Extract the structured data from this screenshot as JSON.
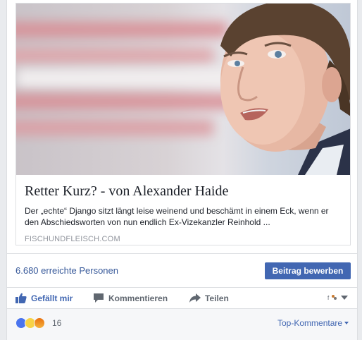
{
  "link_preview": {
    "title": "Retter Kurz? - von Alexander Haide",
    "description": "Der „echte“ Django sitzt längt leise weinend und beschämt in einem Eck, wenn er den Abschiedsworten von nun endlich Ex-Vizekanzler Reinhold ...",
    "domain": "FISCHUNDFLEISCH.COM"
  },
  "reach": {
    "text": "6.680 erreichte Personen",
    "boost_label": "Beitrag bewerben"
  },
  "actions": {
    "like_label": "Gefällt mir",
    "comment_label": "Kommentieren",
    "share_label": "Teilen"
  },
  "reactions": {
    "icons": [
      "like-icon",
      "haha-icon",
      "angry-icon"
    ],
    "count": "16",
    "sort_label": "Top-Kommentare"
  },
  "colors": {
    "link_blue": "#365899",
    "button_blue": "#4267b2",
    "muted_text": "#90949c"
  }
}
